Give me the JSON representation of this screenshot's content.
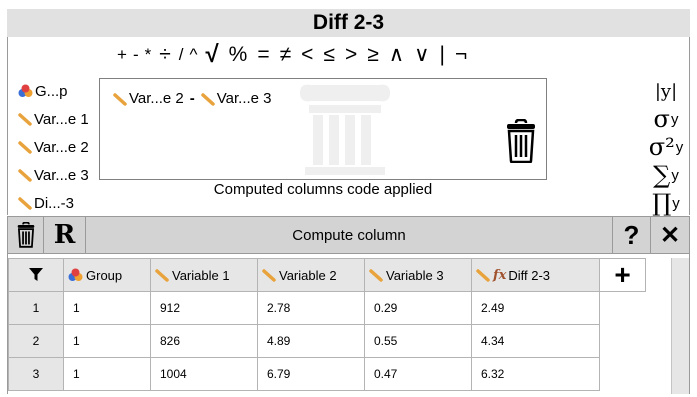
{
  "window": {
    "title": "Diff 2-3"
  },
  "operators": [
    "+",
    "-",
    "*",
    "÷",
    "/",
    "^",
    "√",
    "%",
    "=",
    "≠",
    "<",
    "≤",
    ">",
    "≥",
    "∧",
    "∨",
    "|",
    "¬"
  ],
  "variables": [
    {
      "label": "G...p",
      "icon": "group-icon"
    },
    {
      "label": "Var...e 1",
      "icon": "ruler-icon"
    },
    {
      "label": "Var...e 2",
      "icon": "ruler-icon"
    },
    {
      "label": "Var...e 3",
      "icon": "ruler-icon"
    },
    {
      "label": "Di...-3",
      "icon": "ruler-icon"
    }
  ],
  "code": {
    "token1": "Var...e 2",
    "operator": "-",
    "token2": "Var...e 3"
  },
  "status": "Computed columns code applied",
  "functions": {
    "abs": "|y|",
    "sd_symbol": "σ",
    "var_symbol": "σ²",
    "sum_symbol": "∑",
    "prod_symbol": "∏",
    "arg": "y"
  },
  "toolbar": {
    "r_label": "R",
    "title": "Compute column",
    "help_label": "?",
    "close_label": "✕"
  },
  "table": {
    "columns": [
      "Group",
      "Variable 1",
      "Variable 2",
      "Variable 3",
      "Diff 2-3"
    ],
    "fx_label": "fx",
    "add_label": "+",
    "rows": [
      {
        "n": "1",
        "cells": [
          "1",
          "912",
          "2.78",
          "0.29",
          "2.49"
        ]
      },
      {
        "n": "2",
        "cells": [
          "1",
          "826",
          "4.89",
          "0.55",
          "4.34"
        ]
      },
      {
        "n": "3",
        "cells": [
          "1",
          "1004",
          "6.79",
          "0.47",
          "6.32"
        ]
      }
    ]
  },
  "colors": {
    "ruler": "#e8a33d",
    "group_red": "#e04040",
    "group_blue": "#3a6fd8",
    "group_orange": "#f0a030"
  }
}
